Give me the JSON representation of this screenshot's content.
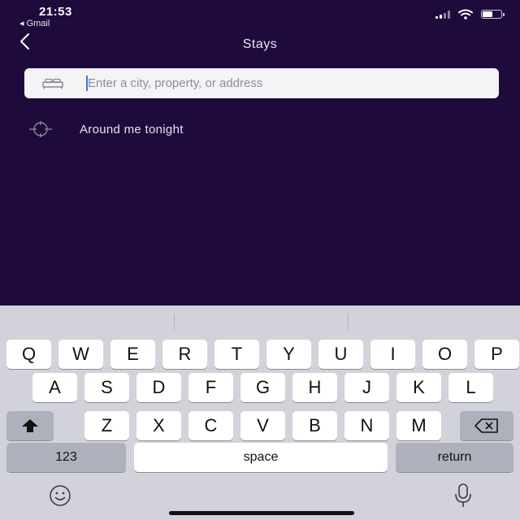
{
  "status_bar": {
    "time": "21:53",
    "back_app": "◂ Gmail",
    "battery_level": 0.55
  },
  "nav": {
    "back_icon": "chevron-left-icon",
    "title": "Stays"
  },
  "search": {
    "icon": "bed-icon",
    "value": "",
    "placeholder": "Enter a city, property, or address"
  },
  "suggestions": [
    {
      "icon": "crosshair-icon",
      "label": "Around me tonight"
    }
  ],
  "keyboard": {
    "row1": [
      "Q",
      "W",
      "E",
      "R",
      "T",
      "Y",
      "U",
      "I",
      "O",
      "P"
    ],
    "row2": [
      "A",
      "S",
      "D",
      "F",
      "G",
      "H",
      "J",
      "K",
      "L"
    ],
    "row3": [
      "Z",
      "X",
      "C",
      "V",
      "B",
      "N",
      "M"
    ],
    "numbers_label": "123",
    "space_label": "space",
    "return_label": "return",
    "shift_icon": "shift-icon",
    "delete_icon": "backspace-icon",
    "emoji_icon": "emoji-icon",
    "mic_icon": "microphone-icon"
  },
  "colors": {
    "background": "#1e0b3c",
    "keyboard": "#d2d3da",
    "cursor": "#3a7bd5"
  }
}
